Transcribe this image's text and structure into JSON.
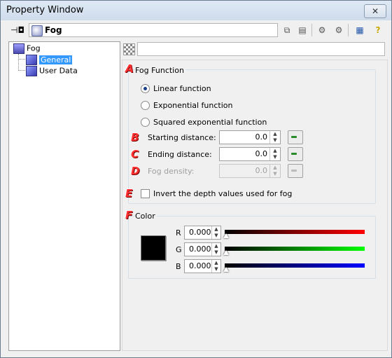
{
  "window": {
    "title": "Property Window"
  },
  "toolbar": {
    "pin_icon": "pin-icon",
    "object_name": "Fog",
    "buttons": [
      "copy-icon",
      "paste-icon",
      "tool-icon",
      "tool-icon-2",
      "view-icon",
      "help-icon"
    ]
  },
  "tree": {
    "root": "Fog",
    "children": [
      "General",
      "User Data"
    ],
    "selected": "General"
  },
  "property_text": "",
  "fog_function": {
    "letter": "A",
    "title": "Fog Function",
    "options": [
      "Linear function",
      "Exponential function",
      "Squared exponential function"
    ],
    "selected": "Linear function"
  },
  "fields": {
    "starting": {
      "letter": "B",
      "label": "Starting distance:",
      "value": "0.0"
    },
    "ending": {
      "letter": "C",
      "label": "Ending distance:",
      "value": "0.0"
    },
    "density": {
      "letter": "D",
      "label": "Fog density:",
      "value": "0.0",
      "disabled": true
    }
  },
  "invert": {
    "letter": "E",
    "label": "Invert the depth values used for fog",
    "checked": false
  },
  "color": {
    "letter": "F",
    "title": "Color",
    "swatch": "#000000",
    "channels": [
      {
        "name": "R",
        "value": "0.000",
        "bar_color": "#ff0000"
      },
      {
        "name": "G",
        "value": "0.000",
        "bar_color": "#00ff00"
      },
      {
        "name": "B",
        "value": "0.000",
        "bar_color": "#0000ff"
      }
    ]
  }
}
